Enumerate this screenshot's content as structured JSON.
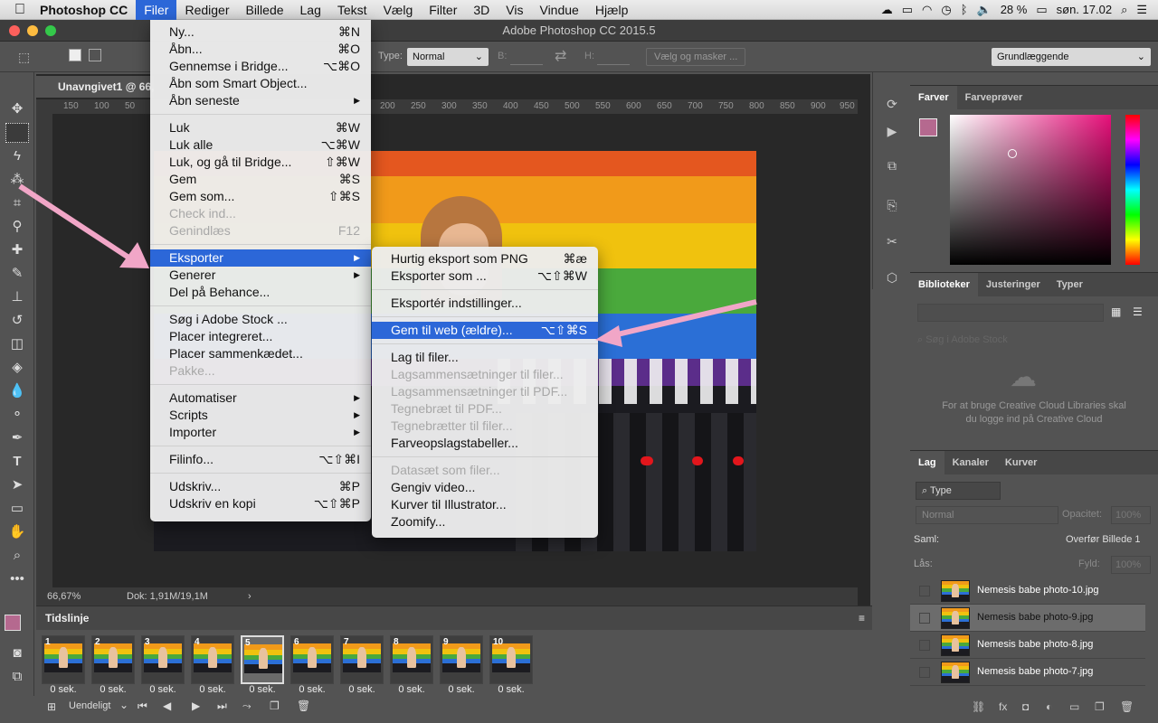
{
  "menubar": {
    "app_name": "Photoshop CC",
    "items": [
      "Filer",
      "Rediger",
      "Billede",
      "Lag",
      "Tekst",
      "Vælg",
      "Filter",
      "3D",
      "Vis",
      "Vindue",
      "Hjælp"
    ],
    "battery": "28 %",
    "clock": "søn. 17.02"
  },
  "window": {
    "title": "Adobe Photoshop CC 2015.5"
  },
  "options": {
    "type_label": "Type:",
    "type_value": "Normal",
    "b_label": "B:",
    "h_label": "H:",
    "select_mask_button": "Vælg og masker ...",
    "workspace": "Grundlæggende"
  },
  "document": {
    "tab_title": "Unavngivet1 @ 66,67% (Nemesis babe photo-5, RGB/8)",
    "ruler_ticks": [
      "150",
      "100",
      "50",
      "0",
      "50",
      "100",
      "150",
      "200",
      "250",
      "300",
      "350",
      "400",
      "450",
      "500",
      "550",
      "600",
      "650",
      "700",
      "750",
      "800",
      "850",
      "900",
      "950",
      "1000",
      "1050",
      "1100",
      "11"
    ],
    "zoom": "66,67%",
    "doc_info": "Dok: 1,91M/19,1M"
  },
  "file_menu": [
    {
      "label": "Ny...",
      "shortcut": "⌘N"
    },
    {
      "label": "Åbn...",
      "shortcut": "⌘O"
    },
    {
      "label": "Gennemse i Bridge...",
      "shortcut": "⌥⌘O"
    },
    {
      "label": "Åbn som Smart Object...",
      "shortcut": ""
    },
    {
      "label": "Åbn seneste",
      "shortcut": "",
      "submenu": true
    },
    {
      "sep": true
    },
    {
      "label": "Luk",
      "shortcut": "⌘W"
    },
    {
      "label": "Luk alle",
      "shortcut": "⌥⌘W"
    },
    {
      "label": "Luk, og gå til Bridge...",
      "shortcut": "⇧⌘W"
    },
    {
      "label": "Gem",
      "shortcut": "⌘S"
    },
    {
      "label": "Gem som...",
      "shortcut": "⇧⌘S"
    },
    {
      "label": "Check ind...",
      "shortcut": "",
      "disabled": true
    },
    {
      "label": "Genindlæs",
      "shortcut": "F12",
      "disabled": true
    },
    {
      "sep": true
    },
    {
      "label": "Eksporter",
      "shortcut": "",
      "submenu": true,
      "highlighted": true
    },
    {
      "label": "Generer",
      "shortcut": "",
      "submenu": true
    },
    {
      "label": "Del på Behance...",
      "shortcut": ""
    },
    {
      "sep": true
    },
    {
      "label": "Søg i Adobe Stock ...",
      "shortcut": ""
    },
    {
      "label": "Placer integreret...",
      "shortcut": ""
    },
    {
      "label": "Placer sammenkædet...",
      "shortcut": ""
    },
    {
      "label": "Pakke...",
      "shortcut": "",
      "disabled": true
    },
    {
      "sep": true
    },
    {
      "label": "Automatiser",
      "shortcut": "",
      "submenu": true
    },
    {
      "label": "Scripts",
      "shortcut": "",
      "submenu": true
    },
    {
      "label": "Importer",
      "shortcut": "",
      "submenu": true
    },
    {
      "sep": true
    },
    {
      "label": "Filinfo...",
      "shortcut": "⌥⇧⌘I"
    },
    {
      "sep": true
    },
    {
      "label": "Udskriv...",
      "shortcut": "⌘P"
    },
    {
      "label": "Udskriv en kopi",
      "shortcut": "⌥⇧⌘P"
    }
  ],
  "export_menu": [
    {
      "label": "Hurtig eksport som PNG",
      "shortcut": "⌘æ"
    },
    {
      "label": "Eksporter som ...",
      "shortcut": "⌥⇧⌘W"
    },
    {
      "sep": true
    },
    {
      "label": "Eksportér indstillinger...",
      "shortcut": ""
    },
    {
      "sep": true
    },
    {
      "label": "Gem til web (ældre)...",
      "shortcut": "⌥⇧⌘S",
      "highlighted": true
    },
    {
      "sep": true
    },
    {
      "label": "Lag til filer...",
      "shortcut": ""
    },
    {
      "label": "Lagsammensætninger til filer...",
      "shortcut": "",
      "disabled": true
    },
    {
      "label": "Lagsammensætninger til PDF...",
      "shortcut": "",
      "disabled": true
    },
    {
      "label": "Tegnebræt til PDF...",
      "shortcut": "",
      "disabled": true
    },
    {
      "label": "Tegnebrætter til filer...",
      "shortcut": "",
      "disabled": true
    },
    {
      "label": "Farveopslagstabeller...",
      "shortcut": ""
    },
    {
      "sep": true
    },
    {
      "label": "Datasæt som filer...",
      "shortcut": "",
      "disabled": true
    },
    {
      "label": "Gengiv video...",
      "shortcut": ""
    },
    {
      "label": "Kurver til Illustrator...",
      "shortcut": ""
    },
    {
      "label": "Zoomify...",
      "shortcut": ""
    }
  ],
  "timeline": {
    "title": "Tidslinje",
    "frames": [
      {
        "num": "1",
        "dur": "0 sek."
      },
      {
        "num": "2",
        "dur": "0 sek."
      },
      {
        "num": "3",
        "dur": "0 sek."
      },
      {
        "num": "4",
        "dur": "0 sek."
      },
      {
        "num": "5",
        "dur": "0 sek.",
        "selected": true
      },
      {
        "num": "6",
        "dur": "0 sek."
      },
      {
        "num": "7",
        "dur": "0 sek."
      },
      {
        "num": "8",
        "dur": "0 sek."
      },
      {
        "num": "9",
        "dur": "0 sek."
      },
      {
        "num": "10",
        "dur": "0 sek."
      }
    ],
    "loop": "Uendeligt"
  },
  "color_panel": {
    "tabs": [
      "Farver",
      "Farveprøver"
    ],
    "swatch_color": "#b5698f"
  },
  "libraries_panel": {
    "tabs": [
      "Biblioteker",
      "Justeringer",
      "Typer"
    ],
    "search_placeholder": "Søg i Adobe Stock",
    "message": "For at bruge Creative Cloud Libraries skal du logge ind på Creative Cloud"
  },
  "layers_panel": {
    "tabs": [
      "Lag",
      "Kanaler",
      "Kurver"
    ],
    "filter": "Type",
    "blend": "Normal",
    "opacity_label": "Opacitet:",
    "opacity": "100%",
    "unify_label": "Saml:",
    "propagate_label": "Overfør Billede 1",
    "lock_label": "Lås:",
    "fill_label": "Fyld:",
    "fill": "100%",
    "layers": [
      "Nemesis babe photo-10.jpg",
      "Nemesis babe photo-9.jpg",
      "Nemesis babe photo-8.jpg",
      "Nemesis babe photo-7.jpg"
    ]
  },
  "colors": {
    "accent": "#2c67d8",
    "arrow": "#f1a6c7",
    "foreground": "#b5698f"
  }
}
